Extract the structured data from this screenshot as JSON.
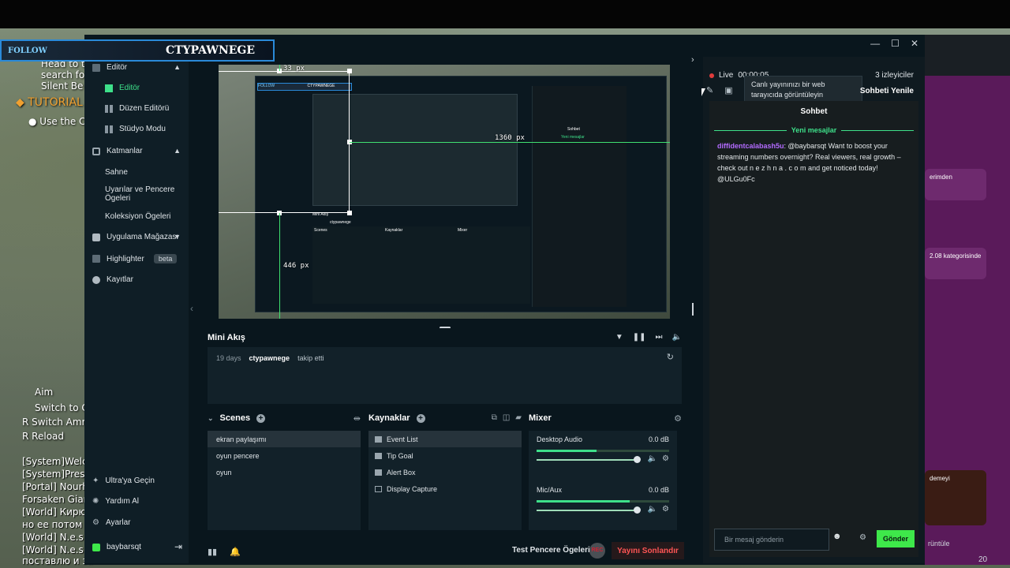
{
  "background": {
    "overlay_lines": [
      "Head to t",
      "search fo",
      "Silent Be"
    ],
    "tutorial_label": "TUTORIAL",
    "use_the": "Use the C",
    "controls": [
      {
        "key": "",
        "text": "Aim"
      },
      {
        "key": "",
        "text": "Switch to C"
      },
      {
        "key": "R",
        "text": "Switch Amm"
      },
      {
        "key": "R",
        "text": "Reload"
      }
    ],
    "log": [
      "[System]Welco",
      "[System]Press",
      "[Portal] Nourha",
      "Forsaken Giant",
      "[World] Кирюш",
      "но ее потом к",
      "[World] N.e.s.s.a",
      "[World] N.e.s.s.a",
      "поставлю и за"
    ]
  },
  "follow_banner": {
    "label": "FOLLOW",
    "name": "CTYPAWNEGE"
  },
  "window": {
    "controls": [
      "—",
      "☐",
      "✕"
    ]
  },
  "nav": {
    "editor_group": "Editör",
    "items": [
      {
        "label": "Editör",
        "active": true
      },
      {
        "label": "Düzen Editörü"
      },
      {
        "label": "Stüdyo Modu"
      }
    ],
    "layers_group": "Katmanlar",
    "layer_items": [
      "Sahne",
      "Uyarılar ve Pencere Ögeleri",
      "Koleksiyon Ögeleri"
    ],
    "store": "Uygulama Mağazası",
    "highlighter": "Highlighter",
    "beta": "beta",
    "recordings": "Kayıtlar",
    "ultra": "Ultra'ya Geçin",
    "help": "Yardım Al",
    "settings": "Ayarlar",
    "user": "baybarsqt"
  },
  "preview": {
    "measure_top": "33 px",
    "measure_right": "1360 px",
    "measure_bottom": "446 px",
    "nested_follow": "FOLLOW",
    "nested_name": "CTYPAWNEGE",
    "nested_mini": "Mini Akış",
    "nested_row": "ctypawnege",
    "nested_scenes": "Scenes",
    "nested_sources": "Kaynaklar",
    "nested_mixer": "Mixer",
    "nested_chat_title": "Sohbet",
    "nested_new": "Yeni mesajlar"
  },
  "mini_flow": {
    "title": "Mini Akış",
    "days": "19 days",
    "user": "ctypawnege",
    "action": "takip etti"
  },
  "scenes": {
    "title": "Scenes",
    "items": [
      "ekran paylaşımı",
      "oyun pencere",
      "oyun"
    ]
  },
  "sources": {
    "title": "Kaynaklar",
    "items": [
      "Event List",
      "Tip Goal",
      "Alert Box",
      "Display Capture"
    ]
  },
  "mixer": {
    "title": "Mixer",
    "channels": [
      {
        "name": "Desktop Audio",
        "db": "0.0 dB",
        "level": 0.45
      },
      {
        "name": "Mic/Aux",
        "db": "0.0 dB",
        "level": 0.7
      }
    ]
  },
  "bottom_bar": {
    "test_label": "Test Pencere Ögeleri",
    "rec_label": "REC",
    "end_stream": "Yayını Sonlandır"
  },
  "chat": {
    "live": "Live",
    "live_time": "00:00:05",
    "viewers": "3 izleyiciler",
    "refresh": "Sohbeti Yenile",
    "tooltip": "Canlı yayınınızı bir web tarayıcıda görüntüleyin",
    "title": "Sohbet",
    "new_messages": "Yeni mesajlar",
    "message_author": "diffidentcalabash5u",
    "message_text": ": @baybarsqt Want to boost your streaming numbers overnight? Real viewers, real growth – check out n e z h n a . c o m and get noticed today! @ULGu0Fc",
    "input_placeholder": "Bir mesaj gönderin",
    "send": "Gönder"
  },
  "browser_right": {
    "cards": [
      "erimden",
      "2.08 kategorisinde",
      "demeyi",
      "rüntüle"
    ],
    "counter": "20"
  }
}
